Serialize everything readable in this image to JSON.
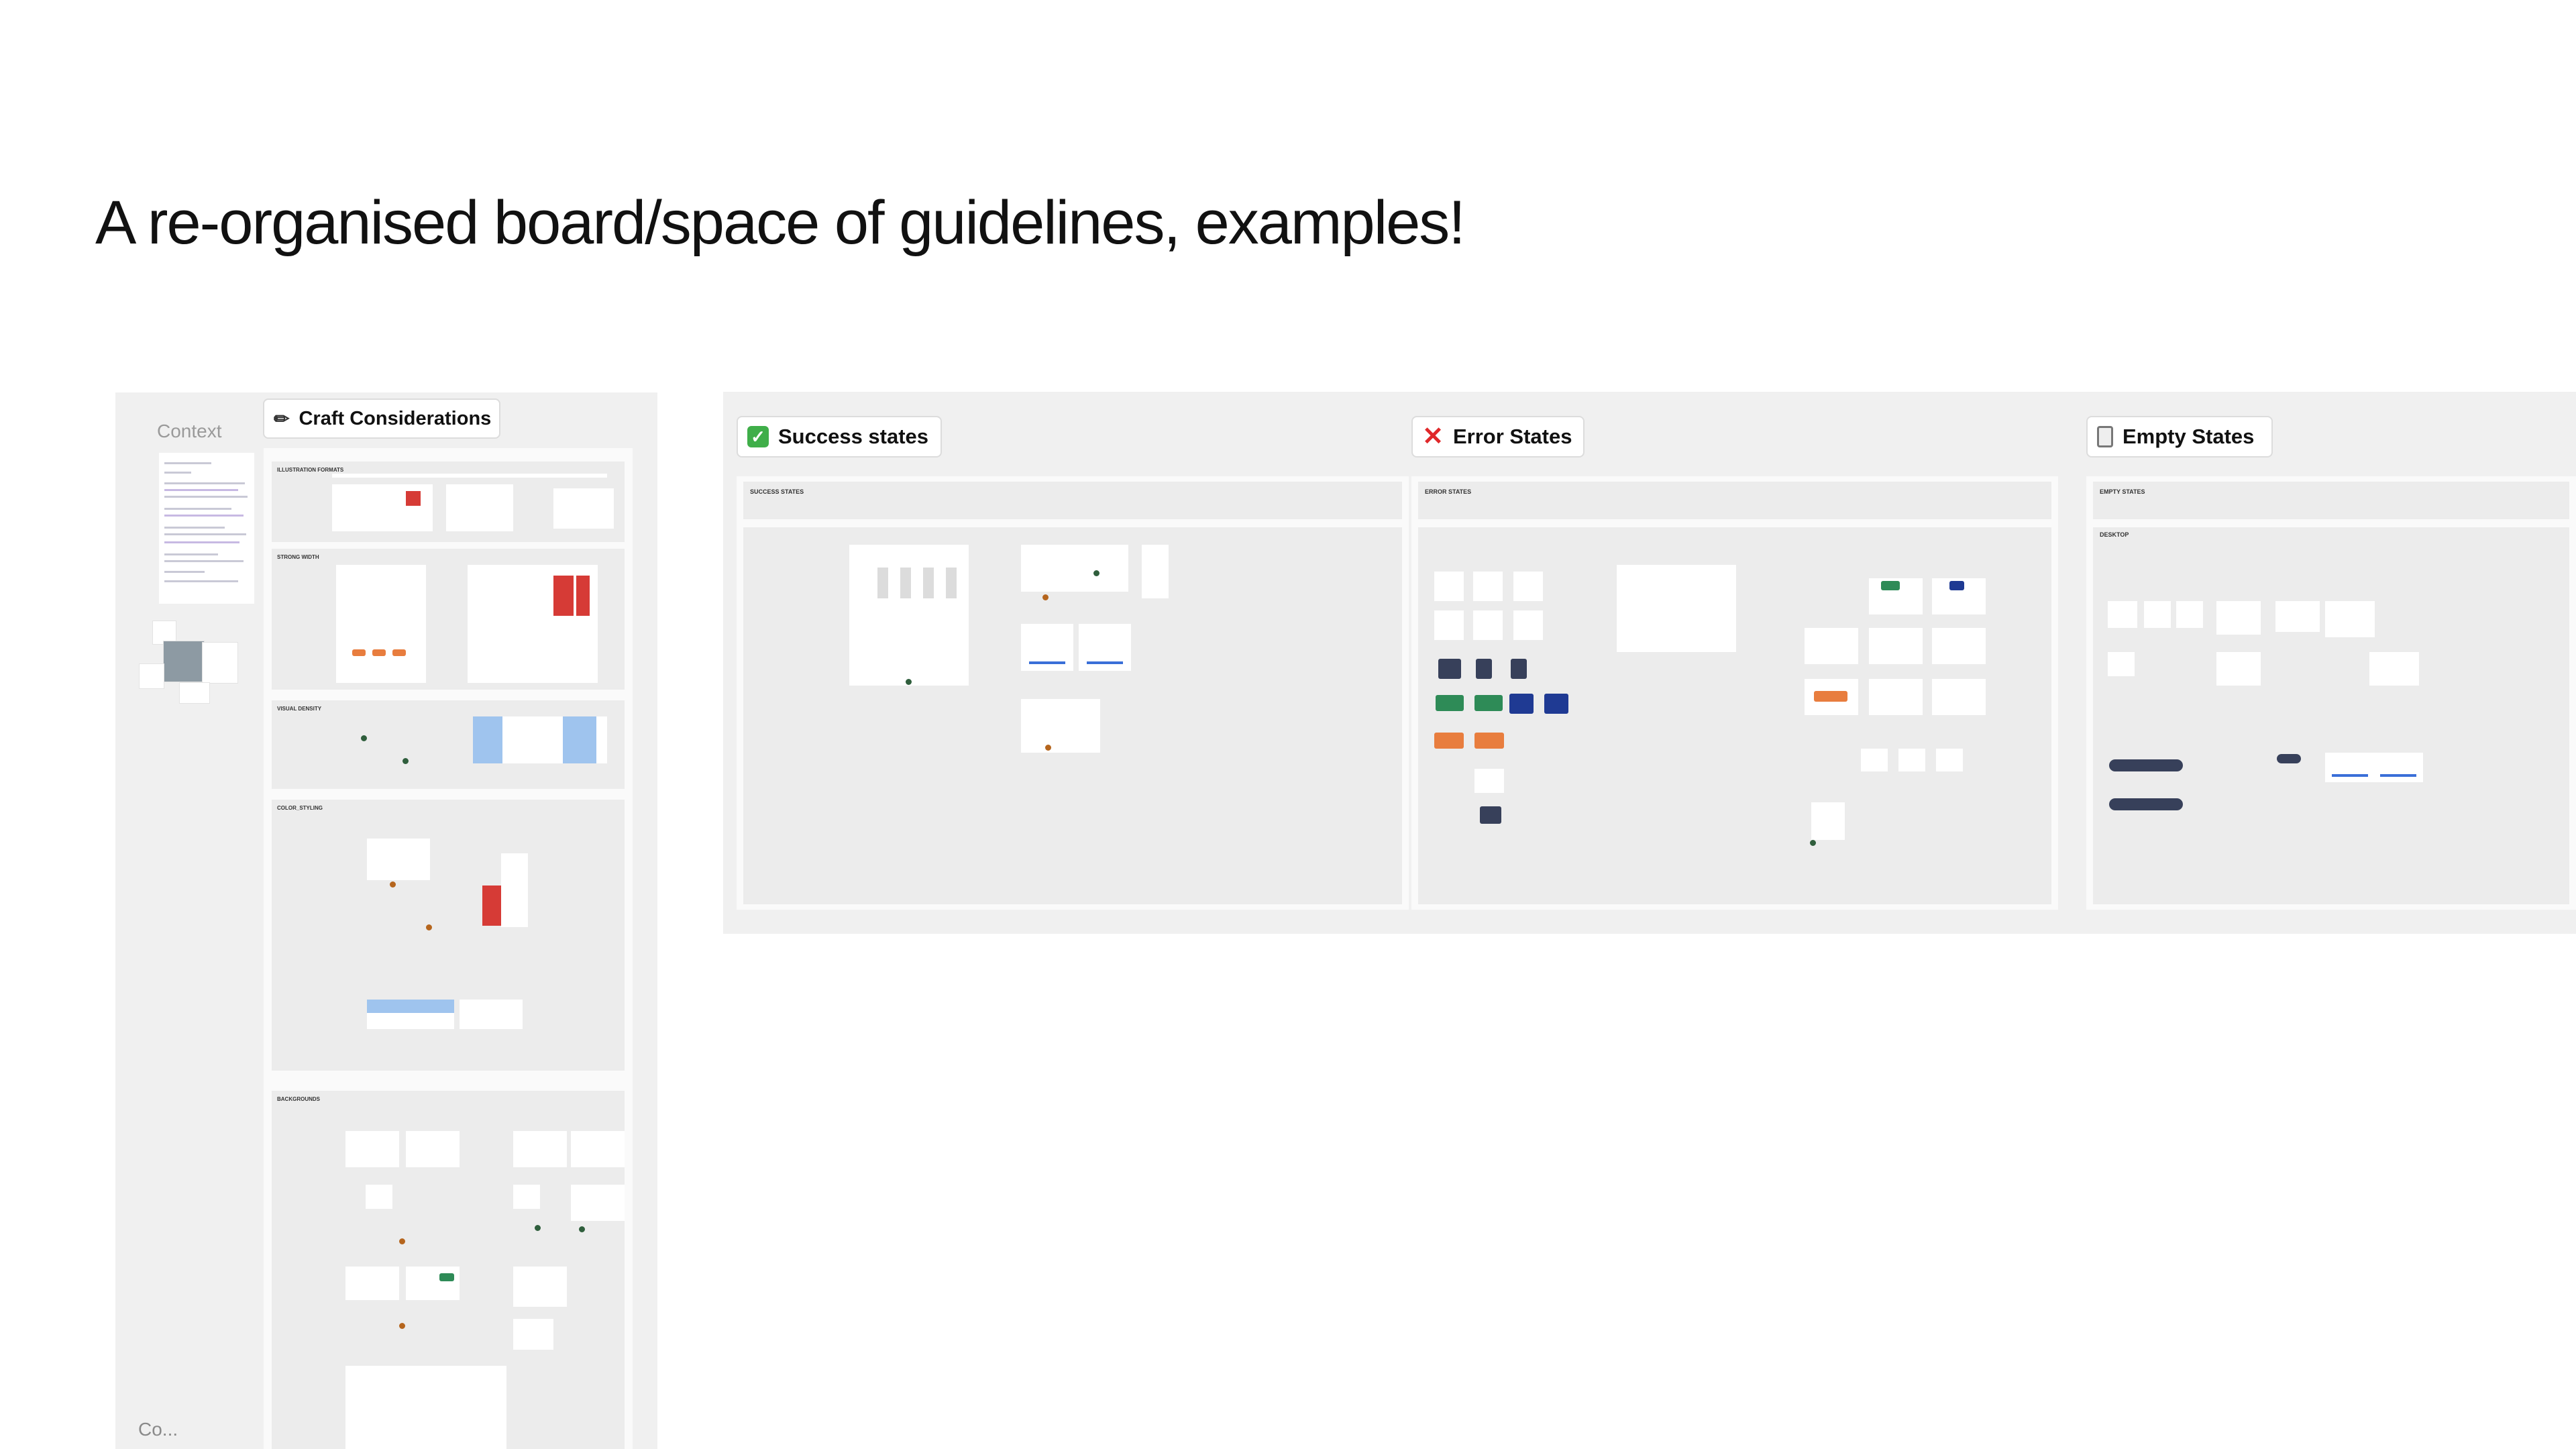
{
  "page": {
    "heading": "A re-organised board/space of guidelines, examples!"
  },
  "left_board": {
    "context_label": "Context",
    "truncated_label": "Co..."
  },
  "craft": {
    "icon": "pencil-icon",
    "label": "Craft Considerations",
    "sections": [
      "ILLUSTRATION FORMATS",
      "STRONG WIDTH",
      "VISUAL DENSITY",
      "COLOR_STYLING",
      "BACKGROUNDS"
    ]
  },
  "states": [
    {
      "icon": "check-icon",
      "label": "Success states",
      "section_title": "SUCCESS STATES",
      "accent": "#3fae49"
    },
    {
      "icon": "x-icon",
      "label": "Error States",
      "section_title": "ERROR STATES",
      "accent": "#e0282a"
    },
    {
      "icon": "hourglass-icon",
      "label": "Empty States",
      "section_title": "EMPTY STATES",
      "subsection": "DESKTOP",
      "accent": "#777777"
    }
  ]
}
